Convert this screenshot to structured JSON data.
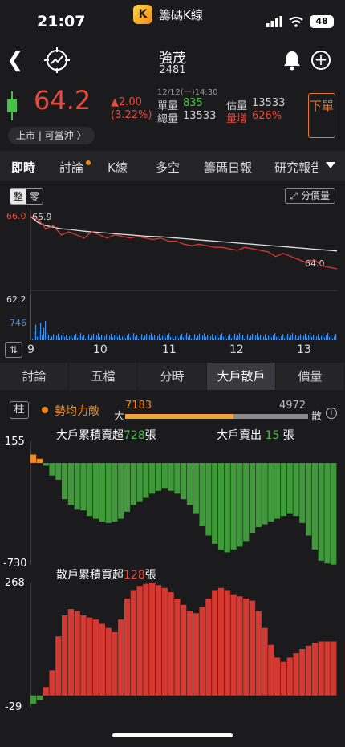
{
  "status": {
    "time": "21:07",
    "app_badge": "K",
    "app_name": "籌碼K線",
    "battery": "48"
  },
  "header": {
    "name": "強茂",
    "code": "2481"
  },
  "quote": {
    "price": "64.2",
    "change": "▲2.00",
    "change_pct": "(3.22%)",
    "datetime": "12/12(一)14:30",
    "single_vol_label": "單量",
    "single_vol": "835",
    "total_vol_label": "總量",
    "total_vol": "13533",
    "est_vol_label": "估量",
    "est_vol": "13533",
    "vol_inc_label": "量增",
    "vol_inc": "626%",
    "order_label": "下單",
    "market_label": "上市 | 可當沖 〉"
  },
  "tabs": [
    "即時",
    "討論",
    "K線",
    "多空",
    "籌碼日報",
    "研究報告"
  ],
  "intraday": {
    "toggle_on": "整",
    "toggle_off": "零",
    "vol_price_label": "分價量",
    "y_high": "66.0",
    "y_ref": "65.9",
    "y_last": "64.0",
    "vol_max": "62.2",
    "vol_side": "746",
    "x_ticks": [
      "9",
      "10",
      "11",
      "12",
      "13"
    ],
    "price_series": [
      65.9,
      65.8,
      65.5,
      65.6,
      65.3,
      65.4,
      65.3,
      65.2,
      65.4,
      65.3,
      65.2,
      65.3,
      65.25,
      65.2,
      65.25,
      65.2,
      65.15,
      65.2,
      65.1,
      65.1,
      65.0,
      64.95,
      65.0,
      64.95,
      64.9,
      64.9,
      64.85,
      64.8,
      64.9,
      64.85,
      64.8,
      64.75,
      64.6,
      64.7,
      64.6,
      64.5,
      64.4,
      64.5,
      64.3,
      64.25,
      64.2
    ],
    "avg_series": [
      65.9,
      65.7,
      65.6,
      65.55,
      65.5,
      65.48,
      65.45,
      65.42,
      65.4,
      65.38,
      65.36,
      65.34,
      65.32,
      65.3,
      65.28,
      65.26,
      65.25,
      65.24,
      65.22,
      65.2,
      65.18,
      65.16,
      65.14,
      65.12,
      65.1,
      65.08,
      65.06,
      65.04,
      65.02,
      65.0,
      64.98,
      64.96,
      64.94,
      64.92,
      64.9,
      64.88,
      64.86,
      64.84,
      64.82,
      64.8,
      64.78
    ]
  },
  "subtabs": [
    "討論",
    "五檔",
    "分時",
    "大戶散戶",
    "價量"
  ],
  "force": {
    "col_label": "柱",
    "label": "勢均力敵",
    "big_label": "大",
    "big_value": "7183",
    "small_label": "散",
    "small_value": "4972",
    "info": "i"
  },
  "big_chart": {
    "title_pre": "大戶累積賣超",
    "title_val": "728",
    "title_post": "張",
    "sell_pre": "大戶賣出",
    "sell_val": "15",
    "sell_post": "張",
    "y_max": "155",
    "y_min": "-730",
    "series": [
      60,
      30,
      -20,
      -90,
      -120,
      -260,
      -300,
      -330,
      -340,
      -380,
      -400,
      -420,
      -430,
      -420,
      -400,
      -350,
      -300,
      -280,
      -250,
      -220,
      -200,
      -180,
      -200,
      -220,
      -260,
      -300,
      -360,
      -450,
      -520,
      -580,
      -620,
      -640,
      -620,
      -600,
      -560,
      -500,
      -460,
      -440,
      -420,
      -400,
      -380,
      -360,
      -380,
      -430,
      -520,
      -620,
      -700,
      -720,
      -728
    ]
  },
  "retail_chart": {
    "title_pre": "散戶累積買超",
    "title_val": "128",
    "title_post": "張",
    "y_max": "268",
    "y_min": "-29",
    "series": [
      -20,
      -10,
      20,
      60,
      140,
      190,
      205,
      200,
      190,
      185,
      180,
      170,
      160,
      150,
      180,
      230,
      250,
      260,
      265,
      268,
      262,
      255,
      245,
      230,
      215,
      200,
      195,
      210,
      230,
      250,
      255,
      250,
      240,
      235,
      230,
      225,
      200,
      160,
      120,
      90,
      80,
      90,
      100,
      110,
      118,
      125,
      128,
      128,
      128
    ]
  },
  "colors": {
    "up": "#e84a3c",
    "down": "#49c04a",
    "accent": "#f08a1a",
    "vol": "#4a8fe0"
  }
}
